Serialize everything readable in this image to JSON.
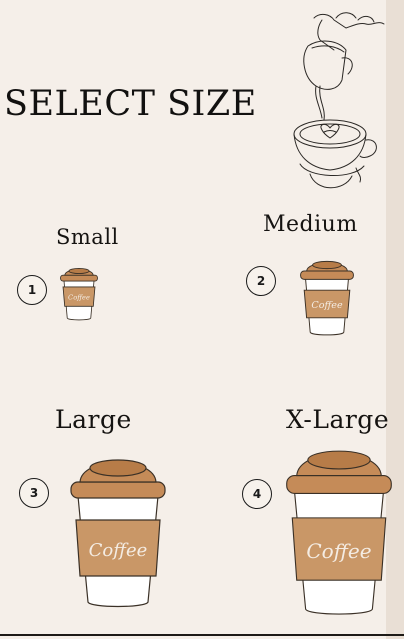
{
  "page": {
    "title": "SELECT SIZE"
  },
  "sizes": [
    {
      "label": "Small",
      "number": "1",
      "cup_text": "Coffee"
    },
    {
      "label": "Medium",
      "number": "2",
      "cup_text": "Coffee"
    },
    {
      "label": "Large",
      "number": "3",
      "cup_text": "Coffee"
    },
    {
      "label": "X-Large",
      "number": "4",
      "cup_text": "Coffee"
    }
  ],
  "colors": {
    "background": "#f5efe9",
    "lid": "#c58b58",
    "sleeve": "#c99767",
    "cup_body": "#ffffff",
    "ink": "#151311"
  },
  "icons": {
    "decoration": "latte-pour-line-art-icon",
    "cup": "coffee-cup-icon"
  }
}
